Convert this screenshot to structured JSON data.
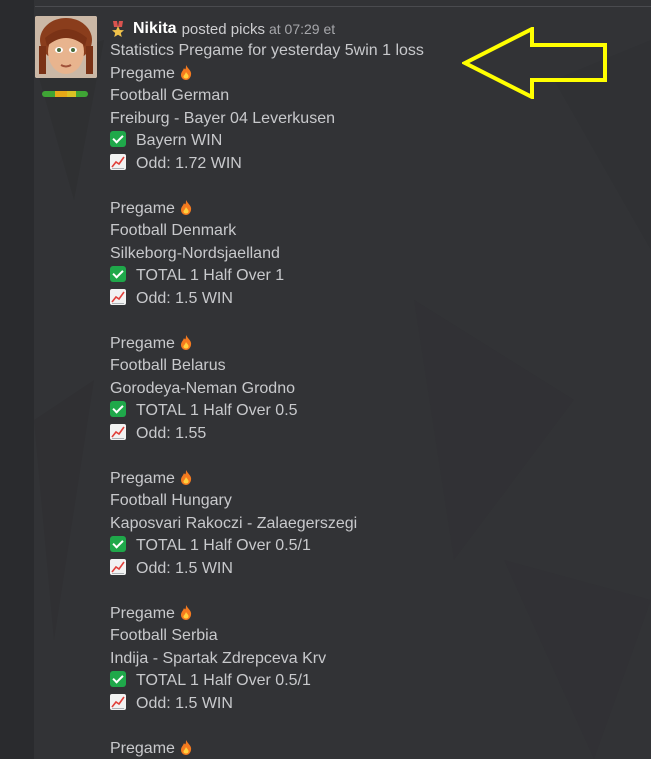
{
  "post": {
    "username": "Nikita",
    "action": "posted picks",
    "time": "at 07:29 et",
    "summary": "Statistics Pregame for yesterday 5win 1 loss",
    "rank_icon": "medal-icon",
    "rating_colors": [
      "#3fa535",
      "#e6a817",
      "#d9c124",
      "#3fa535"
    ]
  },
  "picks": [
    {
      "label": "Pregame",
      "league": "Football German",
      "match": "Freiburg - Bayer 04 Leverkusen",
      "bet": "Bayern WIN",
      "odd": "Odd: 1.72 WIN"
    },
    {
      "label": "Pregame",
      "league": "Football Denmark",
      "match": "Silkeborg-Nordsjaelland",
      "bet": "TOTAL 1 Half Over 1",
      "odd": "Odd: 1.5 WIN"
    },
    {
      "label": "Pregame",
      "league": "Football Belarus",
      "match": "Gorodeya-Neman Grodno",
      "bet": "TOTAL 1 Half Over 0.5",
      "odd": "Odd: 1.55"
    },
    {
      "label": "Pregame",
      "league": "Football Hungary",
      "match": "Kaposvari Rakoczi - Zalaegerszegi",
      "bet": "TOTAL 1 Half Over 0.5/1",
      "odd": "Odd: 1.5 WIN"
    },
    {
      "label": "Pregame",
      "league": "Football Serbia",
      "match": "Indija - Spartak Zdrepceva Krv",
      "bet": "TOTAL 1 Half Over 0.5/1",
      "odd": "Odd: 1.5 WIN"
    },
    {
      "label": "Pregame"
    }
  ],
  "icons": {
    "fire": "fire-icon",
    "check": "check-mark-icon",
    "trend": "chart-increasing-icon",
    "annotation": "yellow-arrow-left-icon"
  },
  "colors": {
    "background": "#28292c",
    "post_background": "#323336",
    "text": "#c8c9cc",
    "username": "#ffffff",
    "check": "#1fa84a",
    "annotation_arrow": "#ffff00"
  }
}
